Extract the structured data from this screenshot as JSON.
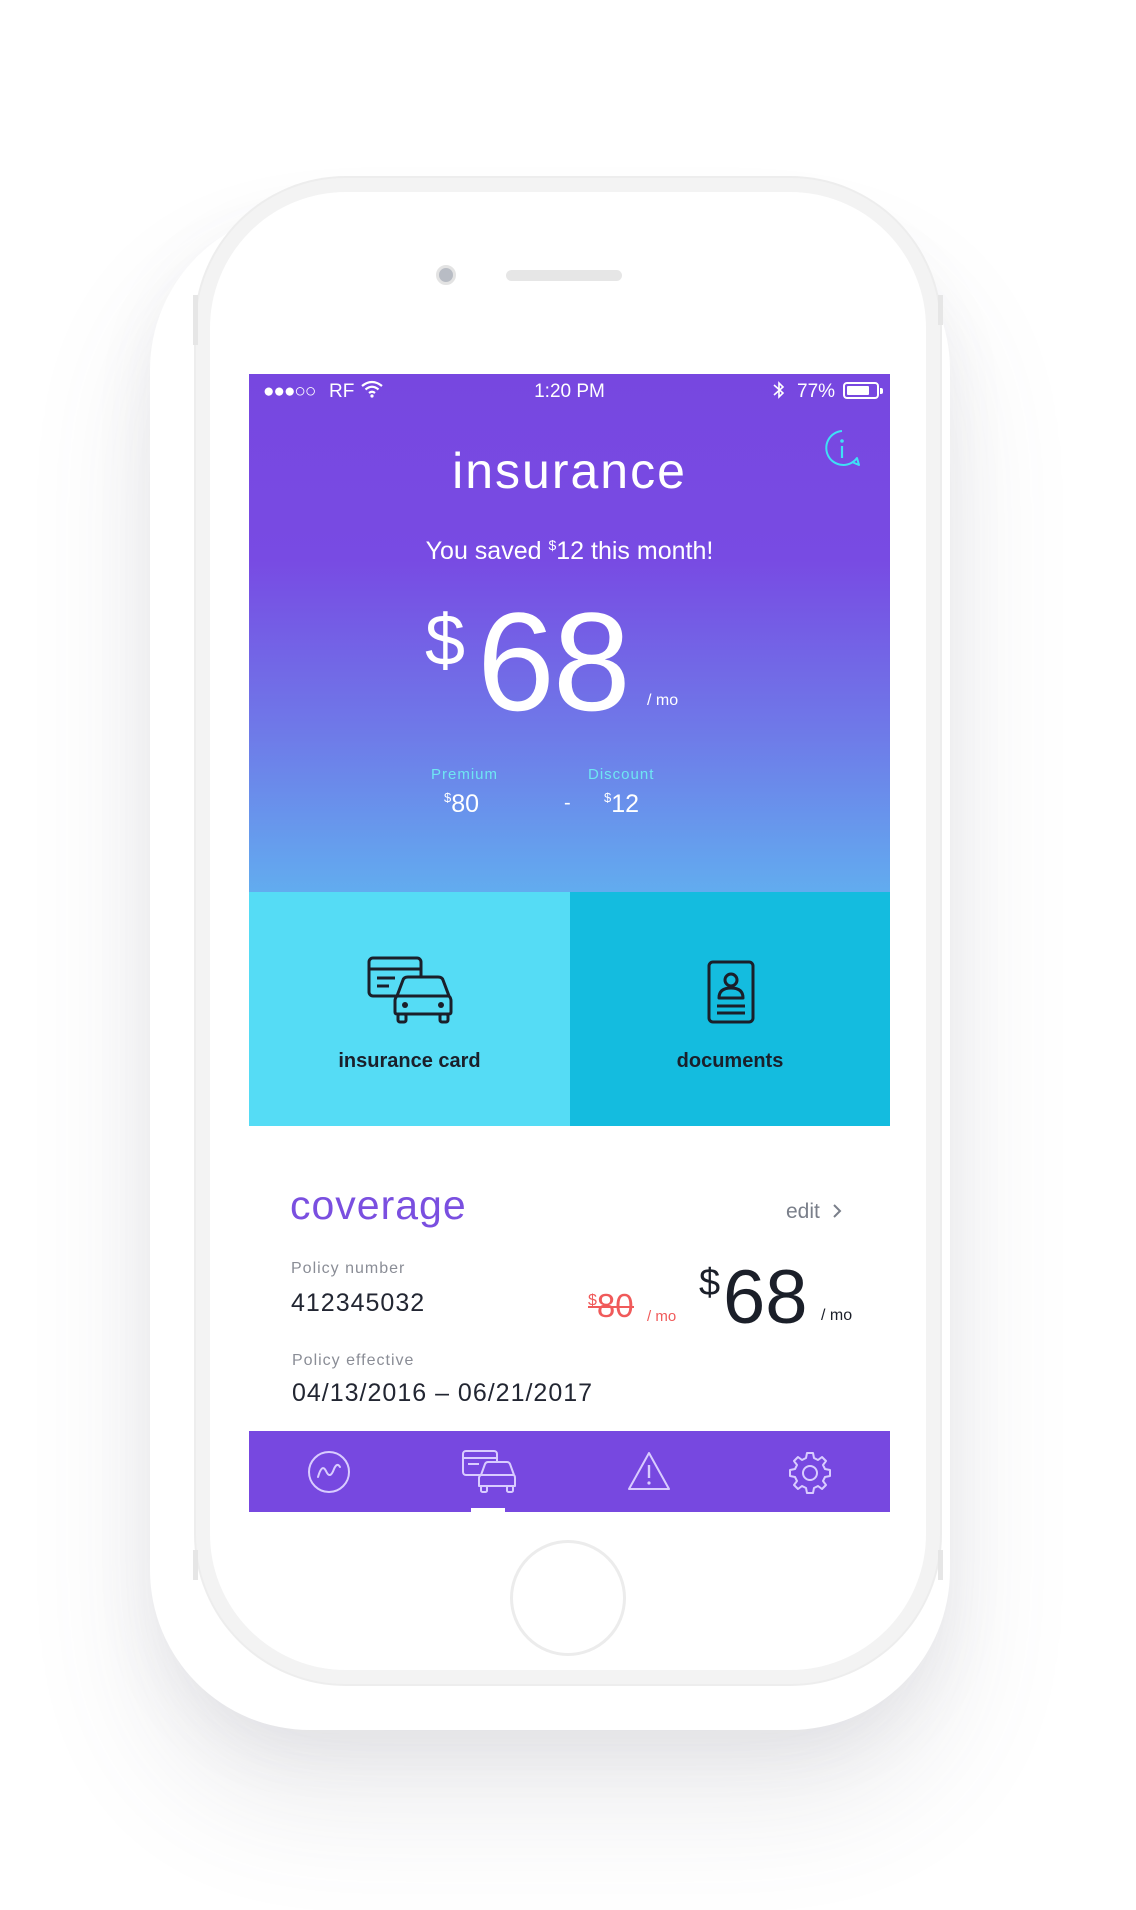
{
  "status_bar": {
    "signal": "●●●○○",
    "carrier": "RF",
    "time": "1:20 PM",
    "battery_percent": "77%",
    "battery_level": 0.77
  },
  "header": {
    "title": "insurance",
    "saved_prefix": "You saved ",
    "saved_currency": "$",
    "saved_amount": "12",
    "saved_suffix": " this month!"
  },
  "price": {
    "currency": "$",
    "amount": "68",
    "period": "/ mo"
  },
  "breakdown": {
    "premium_label": "Premium",
    "premium_currency": "$",
    "premium_value": "80",
    "separator": "-",
    "discount_label": "Discount",
    "discount_currency": "$",
    "discount_value": "12"
  },
  "tiles": {
    "insurance_card_label": "insurance card",
    "documents_label": "documents"
  },
  "coverage": {
    "title": "coverage",
    "edit_label": "edit",
    "policy_number_label": "Policy number",
    "policy_number": "412345032",
    "policy_effective_label": "Policy effective",
    "policy_effective": "04/13/2016 – 06/21/2017",
    "old_price_currency": "$",
    "old_price": "80",
    "old_period": "/ mo",
    "new_price_currency": "$",
    "new_price": "68",
    "new_period": "/ mo"
  },
  "tabbar": {
    "items": [
      {
        "icon": "dashboard-icon",
        "active": false
      },
      {
        "icon": "insurance-icon",
        "active": true
      },
      {
        "icon": "alert-icon",
        "active": false
      },
      {
        "icon": "settings-icon",
        "active": false
      }
    ]
  },
  "colors": {
    "hero_top": "#7747e0",
    "hero_bottom": "#62acef",
    "tile_card": "#55dcf5",
    "tile_docs": "#14bcdf",
    "accent_purple": "#7a4fe0",
    "discount_red": "#f05a5a",
    "info_cyan": "#3fe0f5"
  }
}
